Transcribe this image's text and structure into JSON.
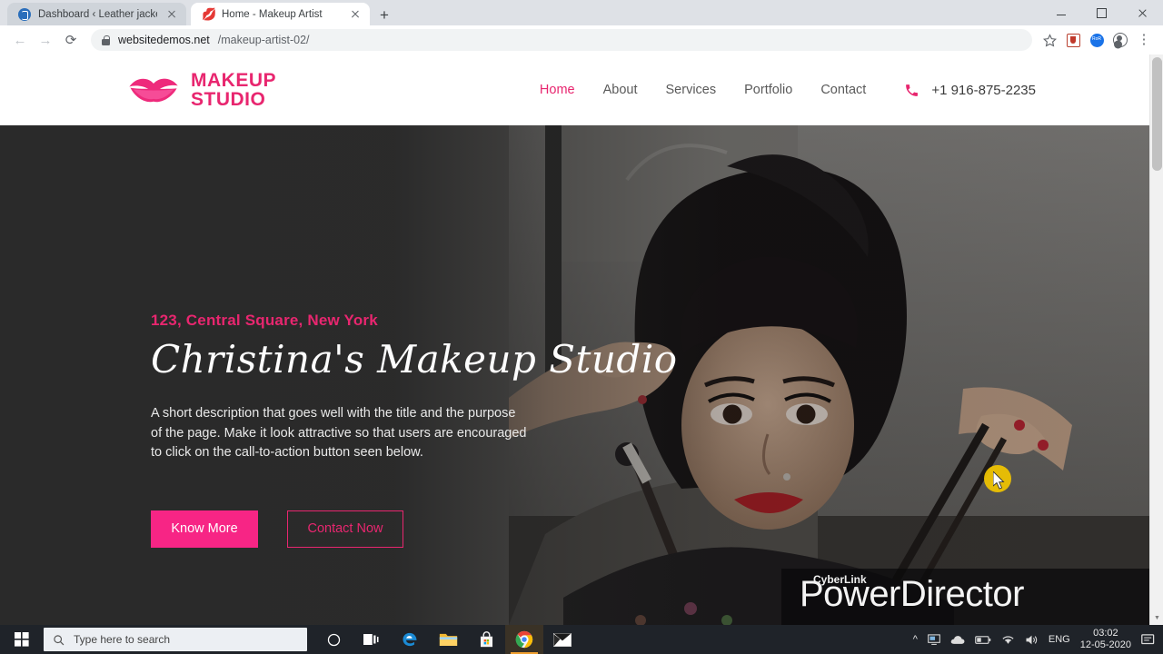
{
  "browser": {
    "tabs": [
      {
        "title": "Dashboard ‹ Leather jacket| Leath",
        "favicon": "dashboard-blue-icon",
        "active": false
      },
      {
        "title": "Home - Makeup Artist",
        "favicon": "lips-pink-icon",
        "active": true
      }
    ],
    "new_tab_label": "+",
    "window_controls": {
      "minimize": "—",
      "maximize": "❐",
      "close": "✕"
    },
    "nav": {
      "back": "←",
      "forward": "→",
      "reload": "⟳"
    },
    "address": {
      "domain": "websitedemos.net",
      "path": "/makeup-artist-02/",
      "lock": "lock-icon"
    },
    "toolbar_icons": [
      "bookmark-star-icon",
      "extension-pocket-icon",
      "extension-blue-icon",
      "profile-avatar-icon",
      "chrome-menu-icon"
    ]
  },
  "site": {
    "logo": {
      "icon": "lips-icon",
      "line1": "MAKEUP",
      "line2": "STUDIO"
    },
    "nav_items": [
      {
        "label": "Home",
        "active": true
      },
      {
        "label": "About",
        "active": false
      },
      {
        "label": "Services",
        "active": false
      },
      {
        "label": "Portfolio",
        "active": false
      },
      {
        "label": "Contact",
        "active": false
      }
    ],
    "phone": {
      "icon": "phone-icon",
      "number": "+1 916-875-2235"
    },
    "hero": {
      "subtitle": "123, Central Square, New York",
      "title": "Christina's Makeup Studio",
      "description": "A short description that goes well with the title and the purpose of the page. Make it look attractive so that users are encouraged to click on the call-to-action button seen below.",
      "primary_button": "Know More",
      "secondary_button": "Contact Now",
      "image_alt": "Woman with dark hair holding makeup brushes"
    }
  },
  "watermark": {
    "brand": "CyberLink",
    "product": "PowerDirector"
  },
  "taskbar": {
    "start": "windows-start-icon",
    "search_placeholder": "Type here to search",
    "search_icon": "search-icon",
    "apps": [
      {
        "name": "cortana-icon"
      },
      {
        "name": "task-view-icon"
      },
      {
        "name": "edge-icon"
      },
      {
        "name": "file-explorer-icon"
      },
      {
        "name": "microsoft-store-icon"
      },
      {
        "name": "chrome-icon",
        "active": true
      },
      {
        "name": "mail-icon"
      }
    ],
    "tray": {
      "chevron": "show-hidden-icons",
      "icons": [
        "monitor-icon",
        "onedrive-cloud-icon",
        "battery-icon",
        "wifi-icon",
        "volume-icon"
      ],
      "language": "ENG",
      "time": "03:02",
      "date": "12-05-2020",
      "action_center": "notifications-icon"
    }
  },
  "colors": {
    "accent_pink": "#e8266f",
    "button_pink": "#f72585",
    "hero_dark": "#2b2b2b",
    "taskbar": "#1f2329"
  }
}
